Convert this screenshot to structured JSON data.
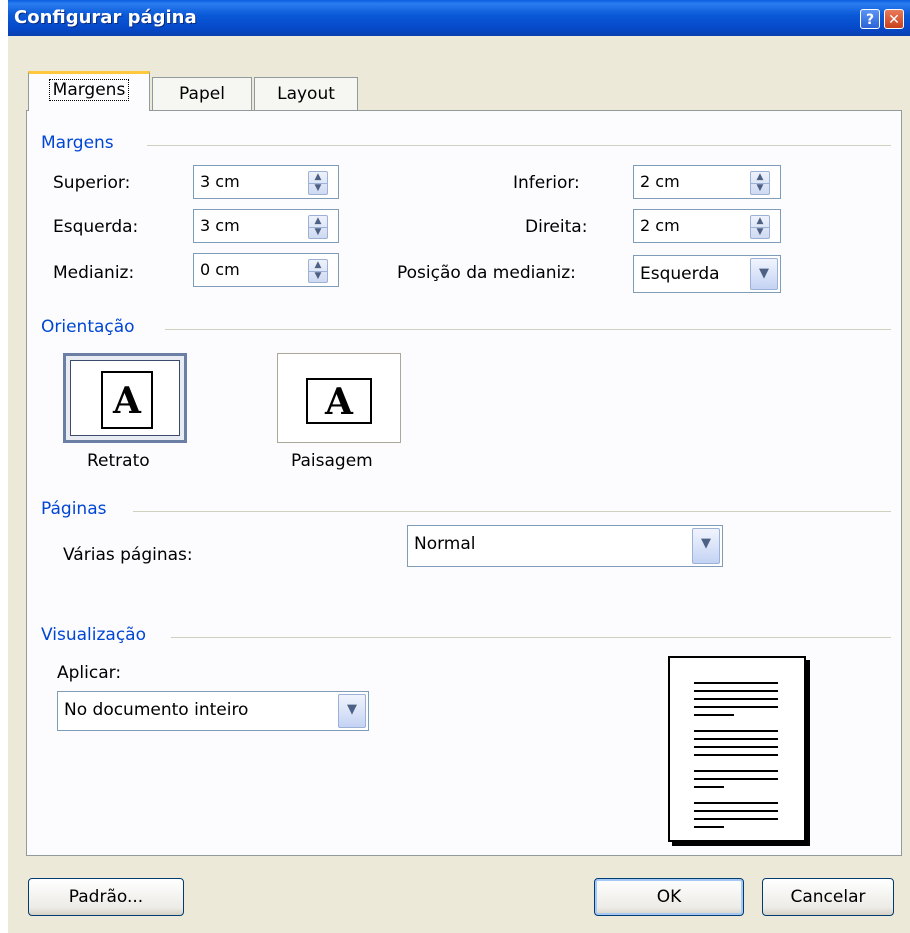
{
  "window": {
    "title": "Configurar página",
    "help_icon": "?",
    "close_icon": "✕"
  },
  "tabs": [
    {
      "label": "Margens",
      "active": true
    },
    {
      "label": "Papel",
      "active": false
    },
    {
      "label": "Layout",
      "active": false
    }
  ],
  "margins": {
    "group_label": "Margens",
    "top_label": "Superior:",
    "top_value": "3 cm",
    "bottom_label": "Inferior:",
    "bottom_value": "2 cm",
    "left_label": "Esquerda:",
    "left_value": "3 cm",
    "right_label": "Direita:",
    "right_value": "2 cm",
    "gutter_label": "Medianiz:",
    "gutter_value": "0 cm",
    "gutter_pos_label": "Posição da medianiz:",
    "gutter_pos_value": "Esquerda"
  },
  "orientation": {
    "group_label": "Orientação",
    "portrait_label": "Retrato",
    "landscape_label": "Paisagem",
    "icon_letter": "A",
    "selected": "portrait"
  },
  "pages": {
    "group_label": "Páginas",
    "multiple_label": "Várias páginas:",
    "multiple_value": "Normal"
  },
  "preview": {
    "group_label": "Visualização",
    "apply_label": "Aplicar:",
    "apply_value": "No documento inteiro"
  },
  "buttons": {
    "default_label": "Padrão...",
    "ok_label": "OK",
    "cancel_label": "Cancelar"
  },
  "colors": {
    "group_label": "#0046d5",
    "titlebar": "#0548c8",
    "tab_highlight": "#ffc83c"
  }
}
